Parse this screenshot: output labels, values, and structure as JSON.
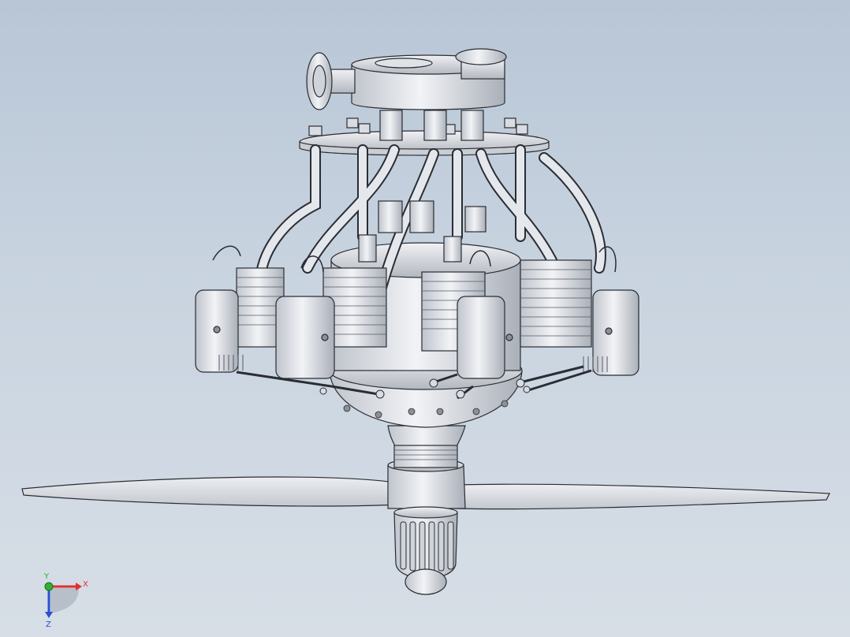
{
  "viewport": {
    "background_top": "#b8c6d6",
    "background_bottom": "#d7dee6",
    "model_fill": "#e4e7ec",
    "model_stroke": "#2a2d33"
  },
  "triad": {
    "x_label": "X",
    "y_label": "Y",
    "z_label": "Z",
    "x_color": "#e03030",
    "y_color": "#30b030",
    "z_color": "#2a4fd0"
  }
}
